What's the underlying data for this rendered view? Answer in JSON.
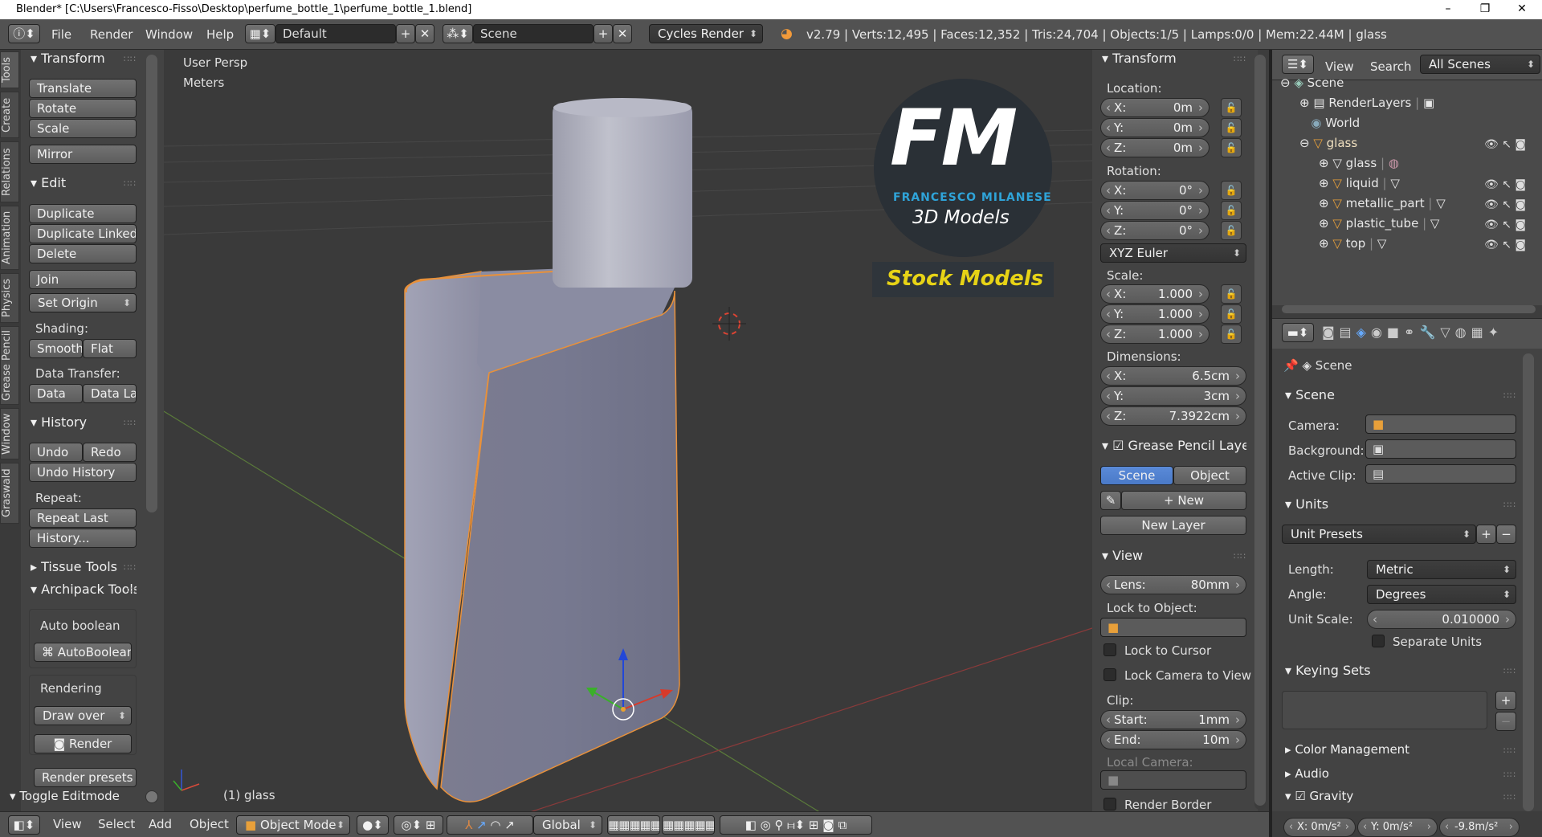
{
  "window": {
    "title": "Blender* [C:\\Users\\Francesco-Fisso\\Desktop\\perfume_bottle_1\\perfume_bottle_1.blend]",
    "minimize": "–",
    "maximize": "❐",
    "close": "✕"
  },
  "topbar": {
    "menus": [
      "File",
      "Render",
      "Window",
      "Help"
    ],
    "layout": "Default",
    "scene": "Scene",
    "engine": "Cycles Render",
    "stats": "v2.79 | Verts:12,495 | Faces:12,352 | Tris:24,704 | Objects:1/5 | Lamps:0/0 | Mem:22.44M | glass"
  },
  "tool_tabs": [
    "Tools",
    "Create",
    "Relations",
    "Animation",
    "Physics",
    "Grease Pencil",
    "Window",
    "Graswald"
  ],
  "toolshelf": {
    "transform_header": "Transform",
    "transform_buttons": [
      "Translate",
      "Rotate",
      "Scale",
      "Mirror"
    ],
    "edit_header": "Edit",
    "edit_buttons": [
      "Duplicate",
      "Duplicate Linked",
      "Delete",
      "Join"
    ],
    "set_origin": "Set Origin",
    "shading_label": "Shading:",
    "smooth": "Smooth",
    "flat": "Flat",
    "data_transfer_label": "Data Transfer:",
    "data": "Data",
    "data_la": "Data La",
    "history_header": "History",
    "undo": "Undo",
    "redo": "Redo",
    "undo_history": "Undo History",
    "repeat_label": "Repeat:",
    "repeat_last": "Repeat Last",
    "history_btn": "History...",
    "tissue_header": "Tissue Tools",
    "archipack_header": "Archipack Tools",
    "auto_boolean": "Auto boolean",
    "auto_boolean_btn": "AutoBoolean",
    "rendering": "Rendering",
    "draw_over": "Draw over",
    "render": "Render",
    "render_presets": "Render presets ...",
    "toggle_editmode": "Toggle Editmode"
  },
  "viewport": {
    "view_name": "User Persp",
    "units": "Meters",
    "object_label": "(1) glass",
    "logo_letters": "FM",
    "logo_name": "FRANCESCO MILANESE",
    "logo_sub": "3D Models",
    "logo_stock": "Stock Models"
  },
  "properties_n": {
    "transform_header": "Transform",
    "location_label": "Location:",
    "location": [
      {
        "axis": "X:",
        "value": "0m"
      },
      {
        "axis": "Y:",
        "value": "0m"
      },
      {
        "axis": "Z:",
        "value": "0m"
      }
    ],
    "rotation_label": "Rotation:",
    "rotation": [
      {
        "axis": "X:",
        "value": "0°"
      },
      {
        "axis": "Y:",
        "value": "0°"
      },
      {
        "axis": "Z:",
        "value": "0°"
      }
    ],
    "rotation_mode": "XYZ Euler",
    "scale_label": "Scale:",
    "scale": [
      {
        "axis": "X:",
        "value": "1.000"
      },
      {
        "axis": "Y:",
        "value": "1.000"
      },
      {
        "axis": "Z:",
        "value": "1.000"
      }
    ],
    "dimensions_label": "Dimensions:",
    "dimensions": [
      {
        "axis": "X:",
        "value": "6.5cm"
      },
      {
        "axis": "Y:",
        "value": "3cm"
      },
      {
        "axis": "Z:",
        "value": "7.3922cm"
      }
    ],
    "grease_header": "Grease Pencil Layer",
    "scene_tab": "Scene",
    "object_tab": "Object",
    "new": "New",
    "new_layer": "New Layer",
    "view_header": "View",
    "lens_label": "Lens:",
    "lens_value": "80mm",
    "lock_to_object": "Lock to Object:",
    "lock_to_cursor": "Lock to Cursor",
    "lock_camera": "Lock Camera to View",
    "clip_label": "Clip:",
    "clip_start_label": "Start:",
    "clip_start": "1mm",
    "clip_end_label": "End:",
    "clip_end": "10m",
    "local_camera": "Local Camera:",
    "render_border": "Render Border"
  },
  "outliner": {
    "view": "View",
    "search": "Search",
    "filter": "All Scenes",
    "items": [
      {
        "name": "Scene"
      },
      {
        "name": "RenderLayers"
      },
      {
        "name": "World"
      },
      {
        "name": "glass"
      },
      {
        "name": "glass"
      },
      {
        "name": "liquid"
      },
      {
        "name": "metallic_part"
      },
      {
        "name": "plastic_tube"
      },
      {
        "name": "top"
      }
    ]
  },
  "scene_props": {
    "breadcrumb": "Scene",
    "scene_header": "Scene",
    "camera_label": "Camera:",
    "background_label": "Background:",
    "active_clip_label": "Active Clip:",
    "units_header": "Units",
    "unit_presets": "Unit Presets",
    "length_label": "Length:",
    "length_value": "Metric",
    "angle_label": "Angle:",
    "angle_value": "Degrees",
    "unit_scale_label": "Unit Scale:",
    "unit_scale_value": "0.010000",
    "separate_units": "Separate Units",
    "keying_header": "Keying Sets",
    "color_mgmt": "Color Management",
    "audio": "Audio",
    "gravity": "Gravity",
    "gravity_x": "X: 0m/s²",
    "gravity_y": "Y: 0m/s²",
    "gravity_z": "-9.8m/s²"
  },
  "bottombar": {
    "view": "View",
    "select": "Select",
    "add": "Add",
    "object": "Object",
    "mode": "Object Mode",
    "orientation": "Global"
  }
}
